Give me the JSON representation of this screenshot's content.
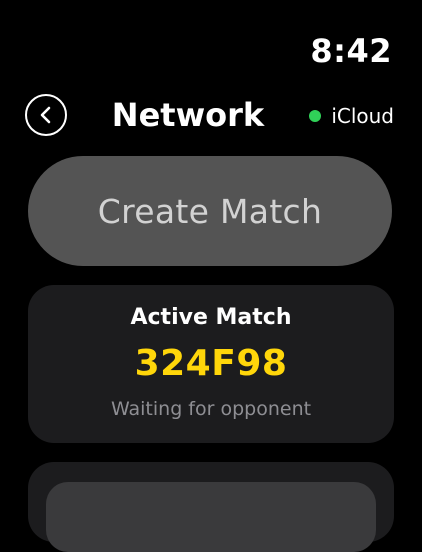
{
  "status_bar": {
    "time": "8:42"
  },
  "nav": {
    "back_icon": "chevron-left-icon",
    "title": "Network",
    "sync_label": "iCloud",
    "sync_dot_color": "#30d158"
  },
  "create_button": {
    "label": "Create Match",
    "background": "#545454"
  },
  "active_match": {
    "title": "Active Match",
    "code": "324F98",
    "code_color": "#ffd60a",
    "status": "Waiting for opponent"
  }
}
